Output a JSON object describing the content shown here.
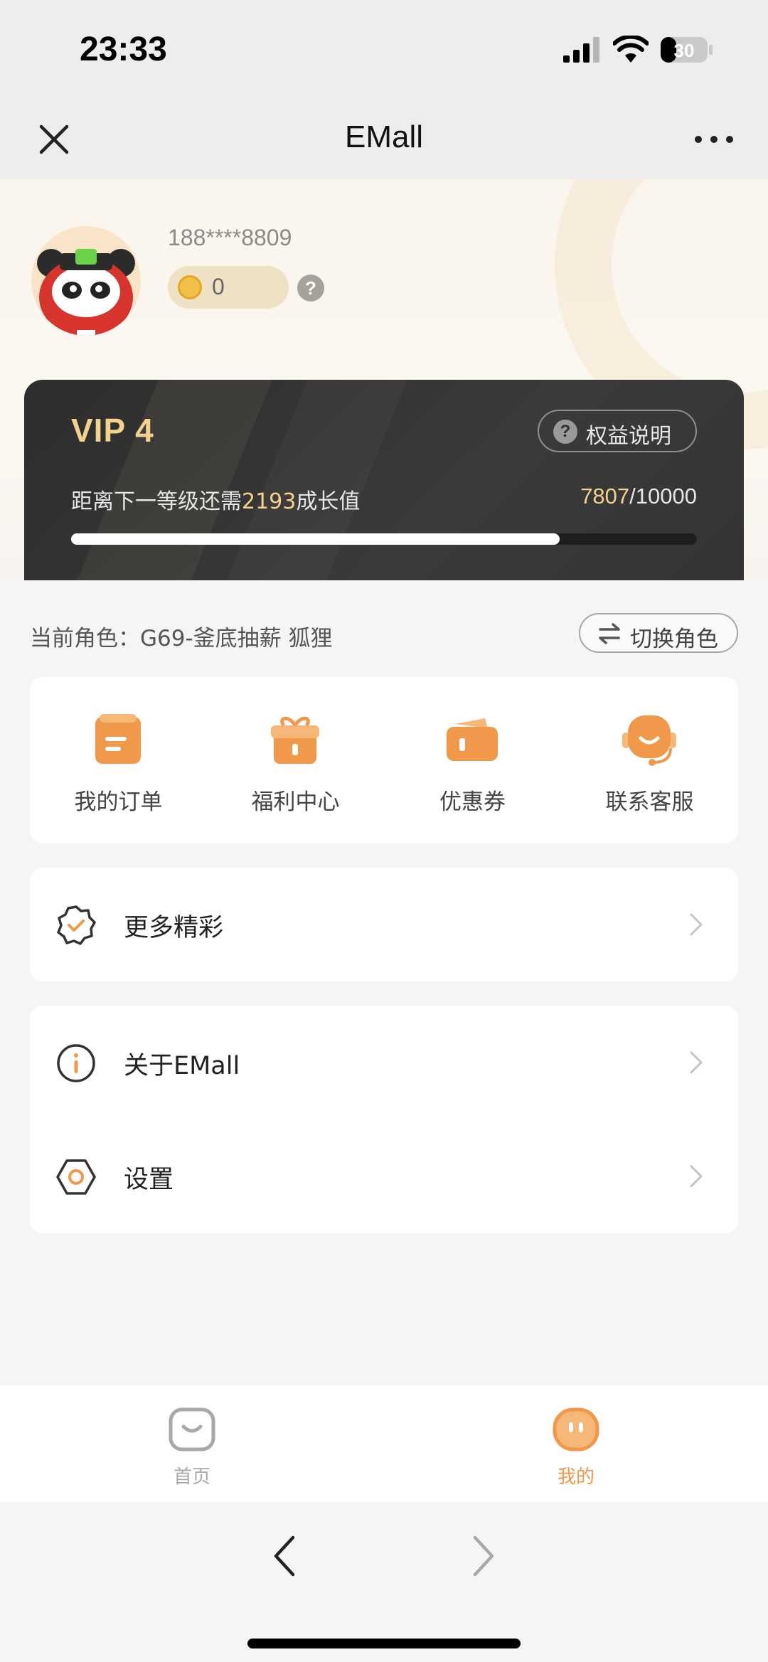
{
  "status_bar": {
    "time": "23:33",
    "battery": "30"
  },
  "nav": {
    "title": "EMall"
  },
  "profile": {
    "phone": "188****8809",
    "coins": "0",
    "help": "?"
  },
  "vip": {
    "level": "VIP 4",
    "rights_label": "权益说明",
    "need_prefix": "距离下一等级还需",
    "need_value": "2193",
    "need_suffix": "成长值",
    "current": "7807",
    "separator": "/",
    "target": "10000",
    "progress_fraction": 0.7807
  },
  "role": {
    "text": "当前角色：G69-釜底抽薪   狐狸",
    "switch_label": "切换角色"
  },
  "quick_actions": [
    {
      "label": "我的订单",
      "icon": "order-icon"
    },
    {
      "label": "福利中心",
      "icon": "gift-icon"
    },
    {
      "label": "优惠券",
      "icon": "coupon-icon"
    },
    {
      "label": "联系客服",
      "icon": "support-icon"
    }
  ],
  "menu": {
    "more": "更多精彩",
    "about": "关于EMall",
    "settings": "设置"
  },
  "tabs": [
    {
      "label": "首页",
      "active": false
    },
    {
      "label": "我的",
      "active": true
    }
  ],
  "colors": {
    "accent": "#f0994a",
    "vip_gold": "#f2d28c",
    "vip_card": "#333333",
    "tab_inactive": "#a8a8a8"
  }
}
